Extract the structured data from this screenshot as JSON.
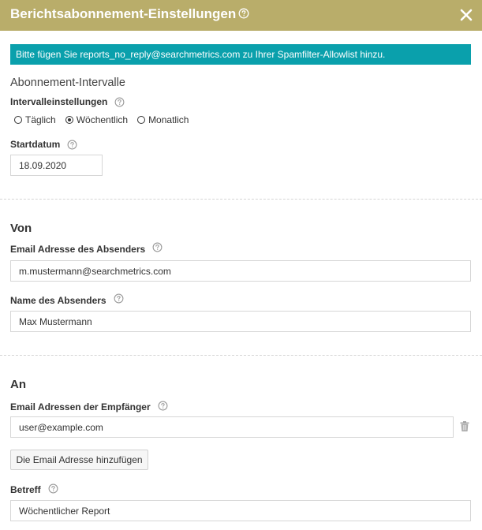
{
  "header": {
    "title": "Berichtsabonnement-Einstellungen",
    "help_icon": "help-circle-icon",
    "close_icon": "close-icon"
  },
  "banner": {
    "text": "Bitte fügen Sie reports_no_reply@searchmetrics.com zu Ihrer Spamfilter-Allowlist hinzu."
  },
  "interval": {
    "subtitle": "Abonnement-Intervalle",
    "settings_label": "Intervalleinstellungen",
    "options": [
      {
        "label": "Täglich",
        "checked": false
      },
      {
        "label": "Wöchentlich",
        "checked": true
      },
      {
        "label": "Monatlich",
        "checked": false
      }
    ],
    "start_label": "Startdatum",
    "start_value": "18.09.2020"
  },
  "from": {
    "title": "Von",
    "email_label": "Email Adresse des Absenders",
    "email_value": "m.mustermann@searchmetrics.com",
    "name_label": "Name des Absenders",
    "name_value": "Max Mustermann"
  },
  "to": {
    "title": "An",
    "recipients_label": "Email Adressen der Empfänger",
    "recipient_value": "user@example.com",
    "delete_icon": "trash-icon",
    "add_button": "Die Email Adresse hinzufügen",
    "subject_label": "Betreff",
    "subject_value": "Wöchentlicher Report"
  },
  "colors": {
    "header_bg": "#b9ad6a",
    "banner_bg": "#0aa0ac",
    "border": "#d6d6d6"
  }
}
